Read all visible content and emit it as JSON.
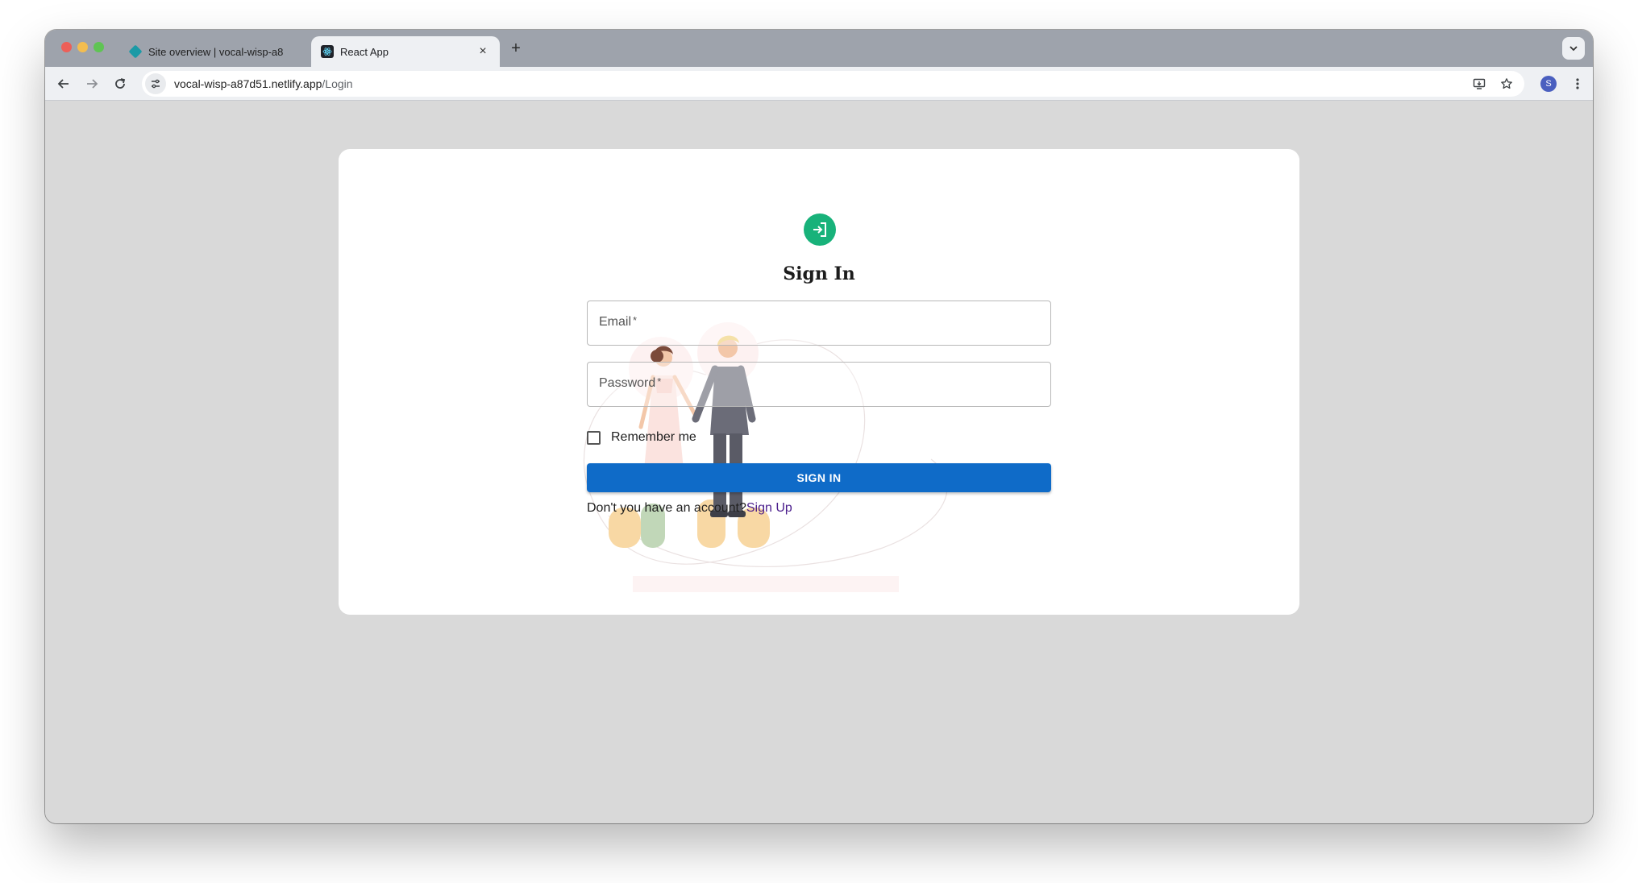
{
  "browser": {
    "tabs": [
      {
        "title": "Site overview | vocal-wisp-a8",
        "icon": "netlify-diamond-icon",
        "active": false
      },
      {
        "title": "React App",
        "icon": "react-icon",
        "active": true
      }
    ],
    "new_tab_label": "+",
    "close_glyph": "×",
    "url_host": "vocal-wisp-a87d51.netlify.app",
    "url_path": "/Login",
    "profile_initial": "S"
  },
  "page": {
    "heading": "Sign In",
    "email_label": "Email",
    "password_label": "Password",
    "required_marker": "*",
    "remember_label": "Remember me",
    "signin_label": "SIGN IN",
    "no_account_text": "Don't you have an account?",
    "signup_link": "Sign Up",
    "accent_color": "#18b27a",
    "button_color": "#0f6bc8"
  }
}
